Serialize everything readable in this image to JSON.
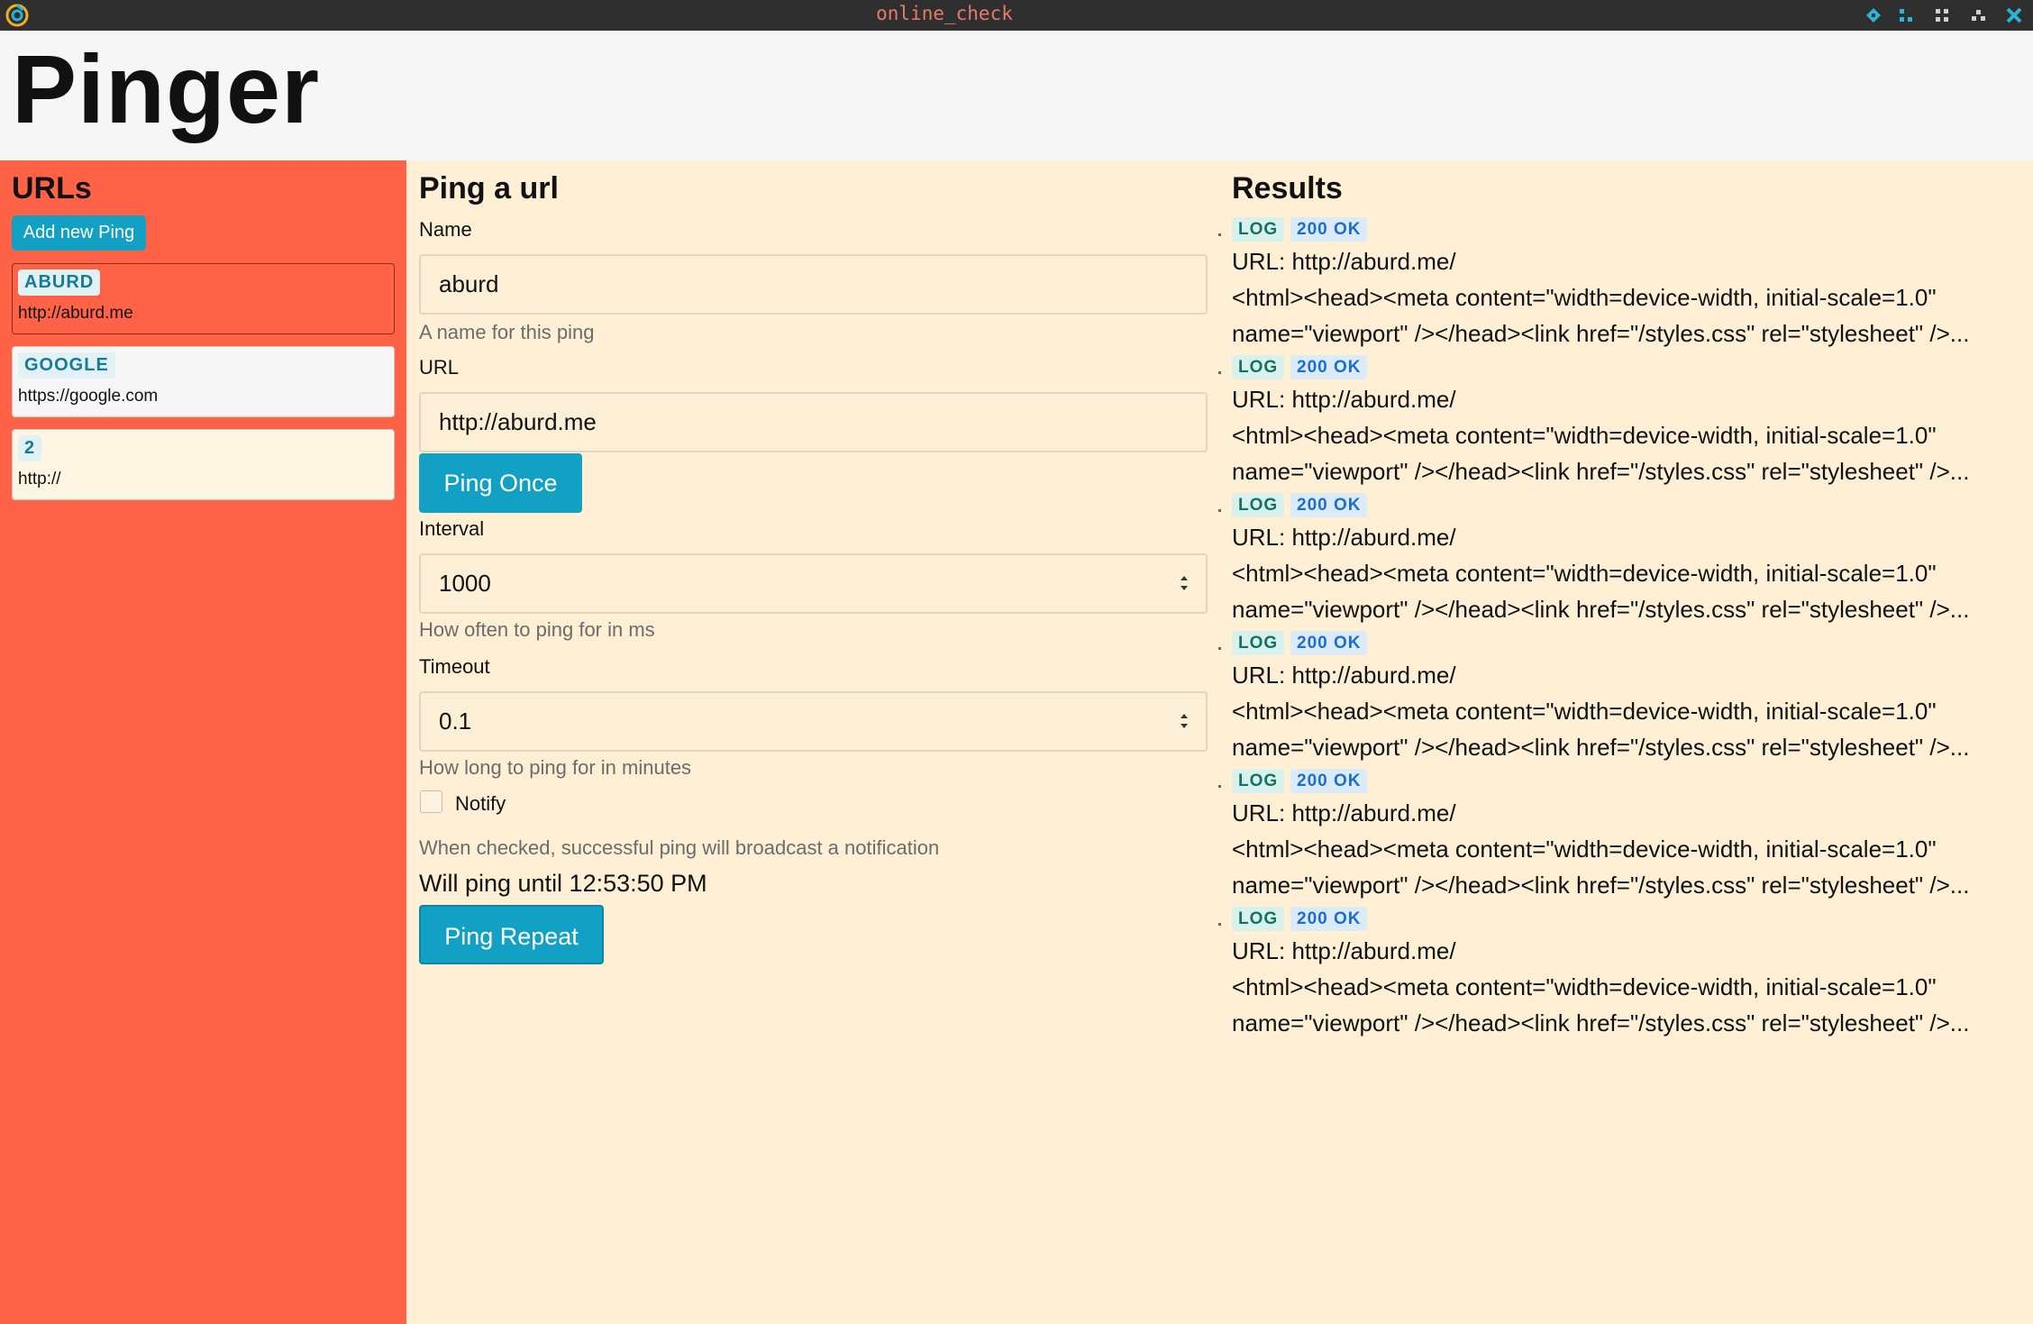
{
  "window": {
    "title": "online_check",
    "app_icon": "app-logo-icon",
    "controls": [
      "diamond-icon",
      "grid-small-icon",
      "grid-icon",
      "minimize-icon",
      "close-icon"
    ]
  },
  "header": {
    "title": "Pinger"
  },
  "sidebar": {
    "heading": "URLs",
    "add_button": "Add new Ping",
    "items": [
      {
        "name": "ABURD",
        "url": "http://aburd.me",
        "selected": true
      },
      {
        "name": "GOOGLE",
        "url": "https://google.com",
        "selected": false
      },
      {
        "name": "2",
        "url": "http://",
        "selected": false
      }
    ]
  },
  "form": {
    "heading": "Ping a url",
    "name": {
      "label": "Name",
      "value": "aburd",
      "help": "A name for this ping"
    },
    "url": {
      "label": "URL",
      "value": "http://aburd.me"
    },
    "ping_once": "Ping Once",
    "interval": {
      "label": "Interval",
      "value": "1000",
      "help": "How often to ping for in ms"
    },
    "timeout": {
      "label": "Timeout",
      "value": "0.1",
      "help": "How long to ping for in minutes"
    },
    "notify": {
      "label": "Notify",
      "checked": false,
      "help": "When checked, successful ping will broadcast a notification"
    },
    "until_text": "Will ping until 12:53:50 PM",
    "ping_repeat": "Ping Repeat"
  },
  "results": {
    "heading": "Results",
    "items": [
      {
        "tag": "LOG",
        "status": "200 OK",
        "url_line": "URL: http://aburd.me/",
        "body_line1": "<html><head><meta content=\"width=device-width, initial-scale=1.0\"",
        "body_line2": "name=\"viewport\" /></head><link href=\"/styles.css\" rel=\"stylesheet\" />..."
      },
      {
        "tag": "LOG",
        "status": "200 OK",
        "url_line": "URL: http://aburd.me/",
        "body_line1": "<html><head><meta content=\"width=device-width, initial-scale=1.0\"",
        "body_line2": "name=\"viewport\" /></head><link href=\"/styles.css\" rel=\"stylesheet\" />..."
      },
      {
        "tag": "LOG",
        "status": "200 OK",
        "url_line": "URL: http://aburd.me/",
        "body_line1": "<html><head><meta content=\"width=device-width, initial-scale=1.0\"",
        "body_line2": "name=\"viewport\" /></head><link href=\"/styles.css\" rel=\"stylesheet\" />..."
      },
      {
        "tag": "LOG",
        "status": "200 OK",
        "url_line": "URL: http://aburd.me/",
        "body_line1": "<html><head><meta content=\"width=device-width, initial-scale=1.0\"",
        "body_line2": "name=\"viewport\" /></head><link href=\"/styles.css\" rel=\"stylesheet\" />..."
      },
      {
        "tag": "LOG",
        "status": "200 OK",
        "url_line": "URL: http://aburd.me/",
        "body_line1": "<html><head><meta content=\"width=device-width, initial-scale=1.0\"",
        "body_line2": "name=\"viewport\" /></head><link href=\"/styles.css\" rel=\"stylesheet\" />..."
      },
      {
        "tag": "LOG",
        "status": "200 OK",
        "url_line": "URL: http://aburd.me/",
        "body_line1": "<html><head><meta content=\"width=device-width, initial-scale=1.0\"",
        "body_line2": "name=\"viewport\" /></head><link href=\"/styles.css\" rel=\"stylesheet\" />..."
      }
    ]
  },
  "colors": {
    "sidebar_bg": "#ff6347",
    "content_bg": "#ffefd4",
    "accent": "#12a0c4",
    "titlebar_bg": "#2f2f2f",
    "title_text": "#e8796c"
  }
}
